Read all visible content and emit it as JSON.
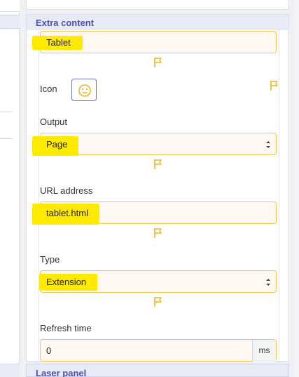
{
  "card": {
    "title": "Extra content"
  },
  "fields": {
    "name_value": "Tablet",
    "icon_label": "Icon",
    "output_label": "Output",
    "output_value": "Page",
    "url_label": "URL address",
    "url_value": "tablet.html",
    "type_label": "Type",
    "type_value": "Extension",
    "refresh_label": "Refresh time",
    "refresh_value": "0",
    "refresh_unit": "ms"
  },
  "bottom_card": {
    "title": "Laser panel"
  },
  "colors": {
    "accent": "#4a52a8",
    "field_border": "#f0c64a",
    "highlight": "#ffea00",
    "flag": "#e8b520"
  },
  "icons": {
    "flag": "flag-icon",
    "face": "neutral-face-icon",
    "select": "select-arrows-icon"
  }
}
